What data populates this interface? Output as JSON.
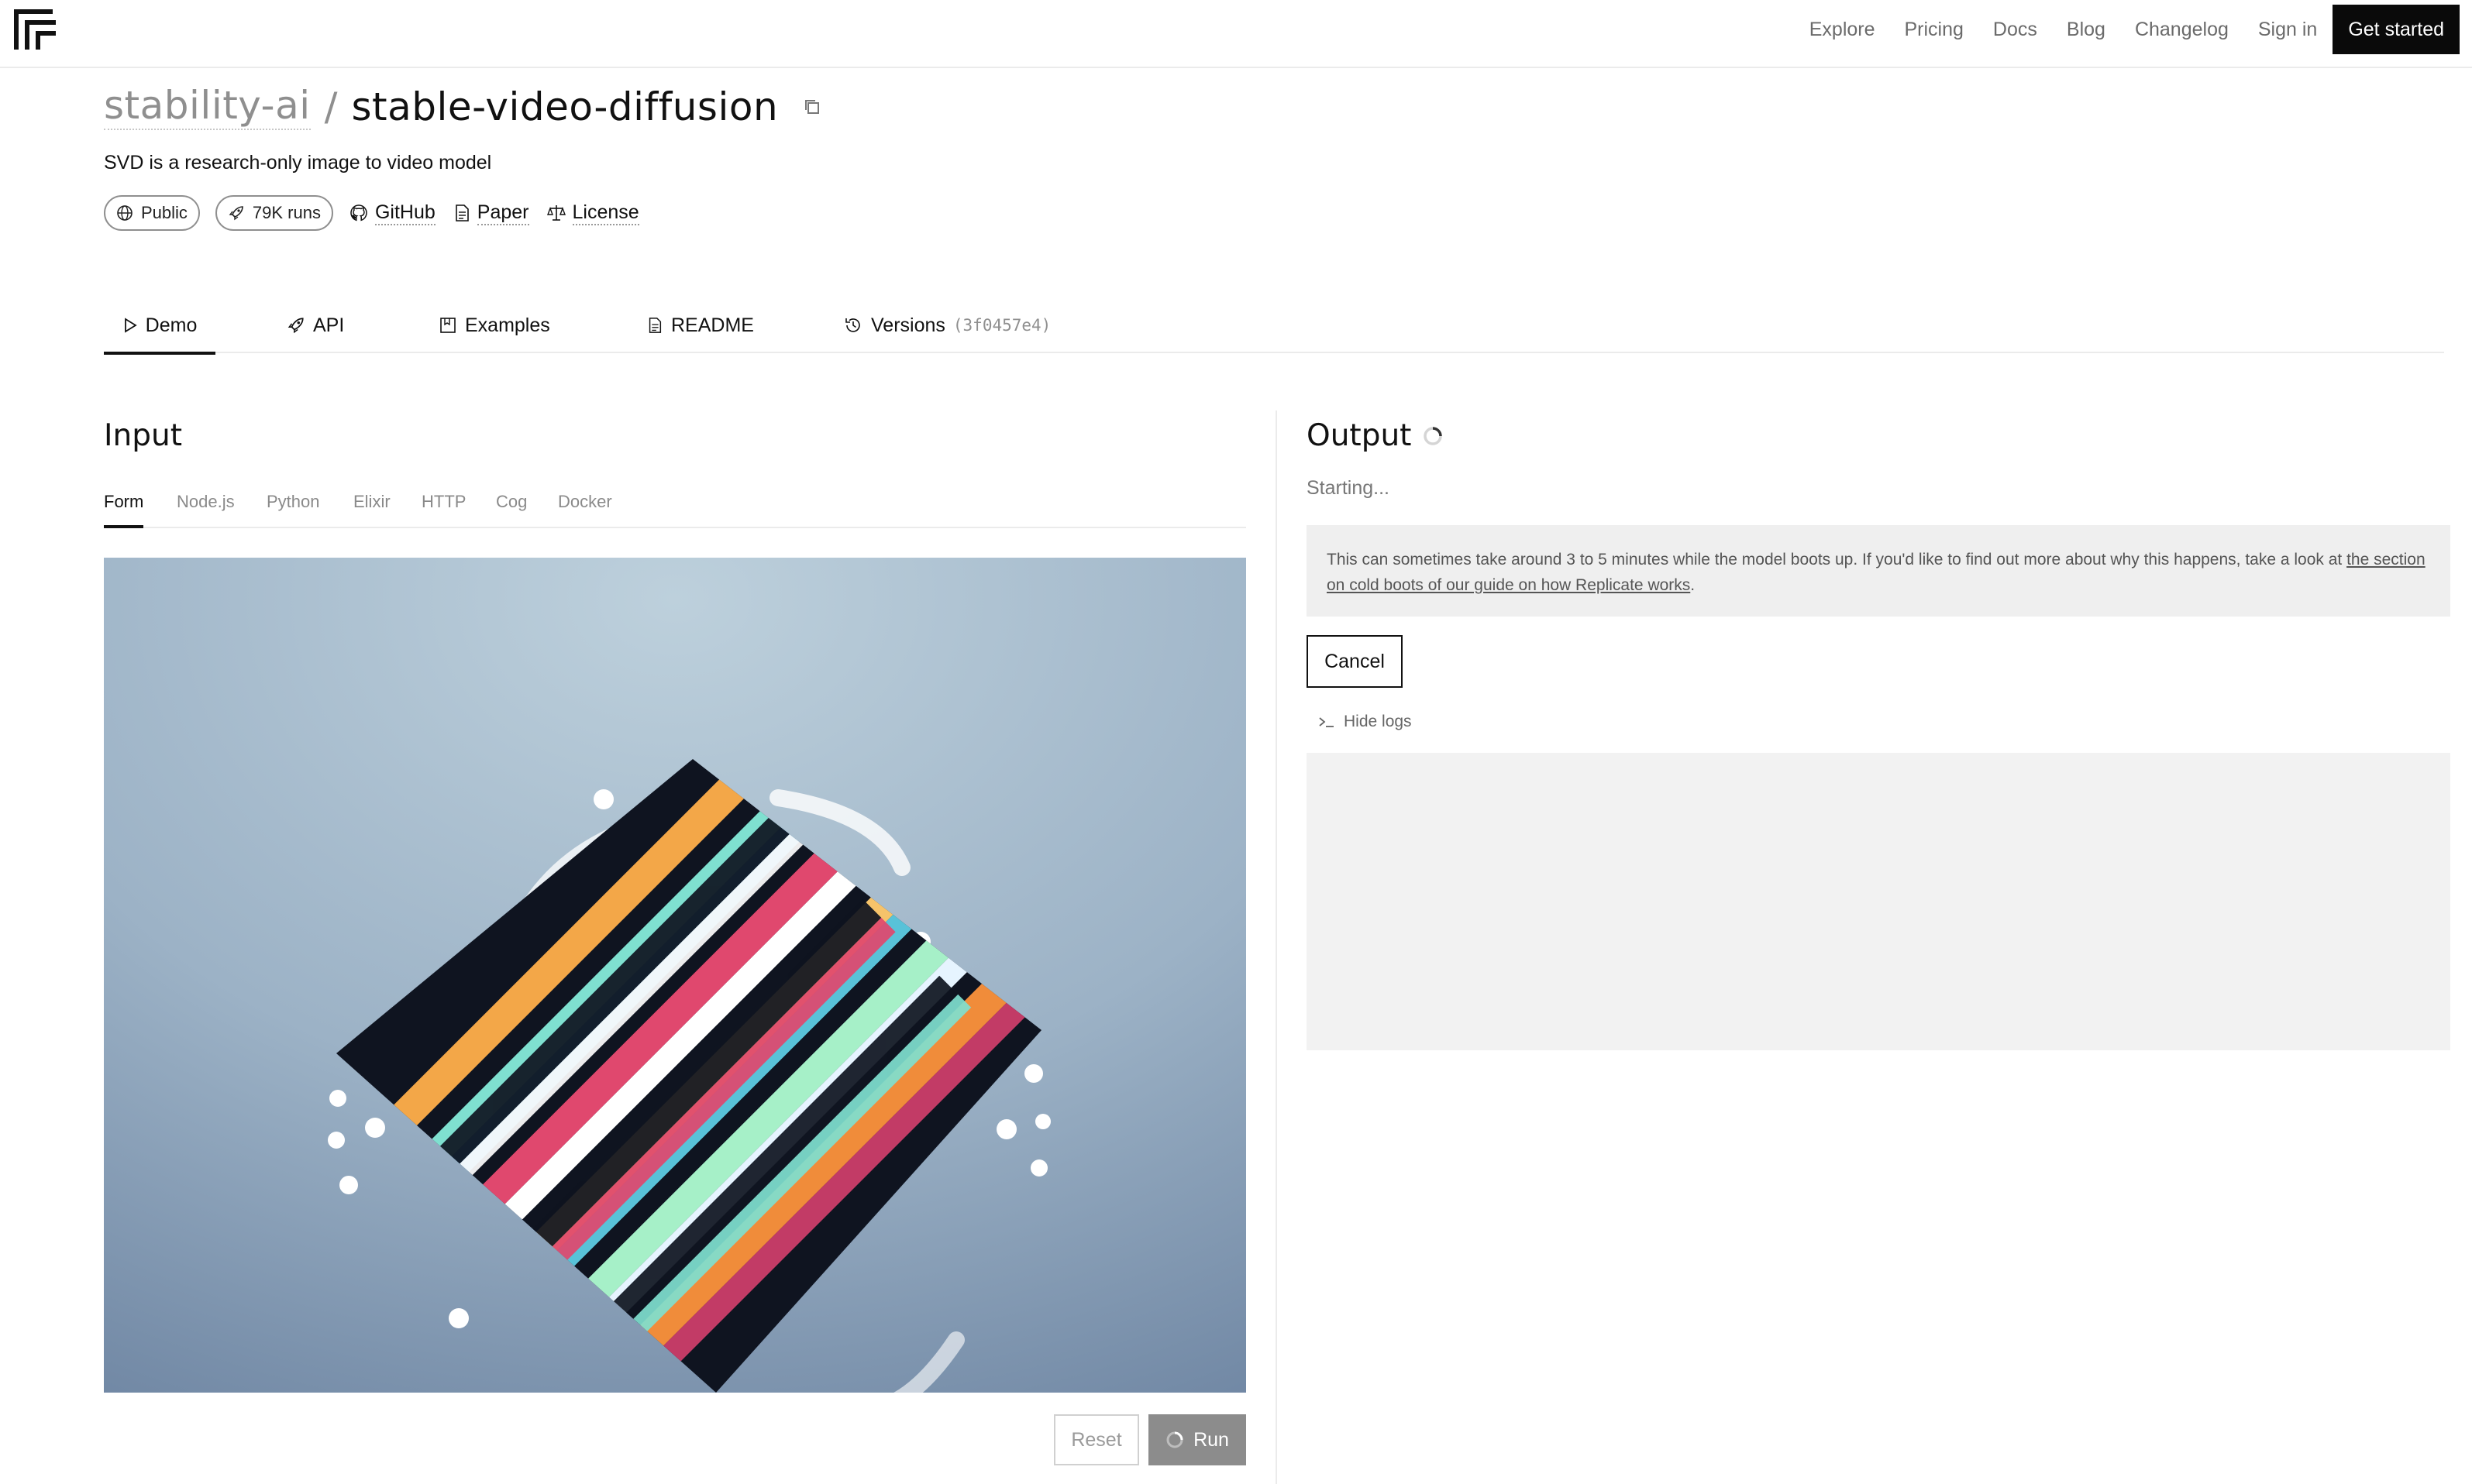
{
  "nav": {
    "links": [
      "Explore",
      "Pricing",
      "Docs",
      "Blog",
      "Changelog",
      "Sign in"
    ],
    "cta": "Get started"
  },
  "header": {
    "owner": "stability-ai",
    "separator": "/",
    "model": "stable-video-diffusion",
    "description": "SVD is a research-only image to video model",
    "visibility": "Public",
    "runs": "79K runs",
    "links": {
      "github": "GitHub",
      "paper": "Paper",
      "license": "License"
    }
  },
  "tabs": {
    "demo": "Demo",
    "api": "API",
    "examples": "Examples",
    "readme": "README",
    "versions": "Versions",
    "version_hash": "(3f0457e4)"
  },
  "input": {
    "title": "Input",
    "subtabs": [
      "Form",
      "Node.js",
      "Python",
      "Elixir",
      "HTTP",
      "Cog",
      "Docker"
    ],
    "active_subtab": "Form",
    "reset_label": "Reset",
    "run_label": "Run"
  },
  "output": {
    "title": "Output",
    "status": "Starting...",
    "notice_text": "This can sometimes take around 3 to 5 minutes while the model boots up. If you'd like to find out more about why this happens, take a look at ",
    "notice_link": "the section on cold boots of our guide on how Replicate works",
    "notice_end": ".",
    "cancel_label": "Cancel",
    "logs_toggle": "Hide logs"
  },
  "colors": {
    "accent": "#0a0a0a",
    "muted_text": "#8f8f8f",
    "panel_bg": "#efefef",
    "run_button_bg": "#8c8c8c"
  },
  "icons": {
    "logo": "replicate-logo-icon",
    "copy": "copy-icon",
    "public": "globe-icon",
    "runs": "rocket-icon",
    "github": "github-icon",
    "paper": "document-icon",
    "license": "scale-icon",
    "demo": "play-icon",
    "api": "rocket-icon",
    "examples": "bookmark-icon",
    "readme": "document-icon",
    "versions": "history-icon",
    "loading": "spinner-icon",
    "terminal": "terminal-icon"
  }
}
